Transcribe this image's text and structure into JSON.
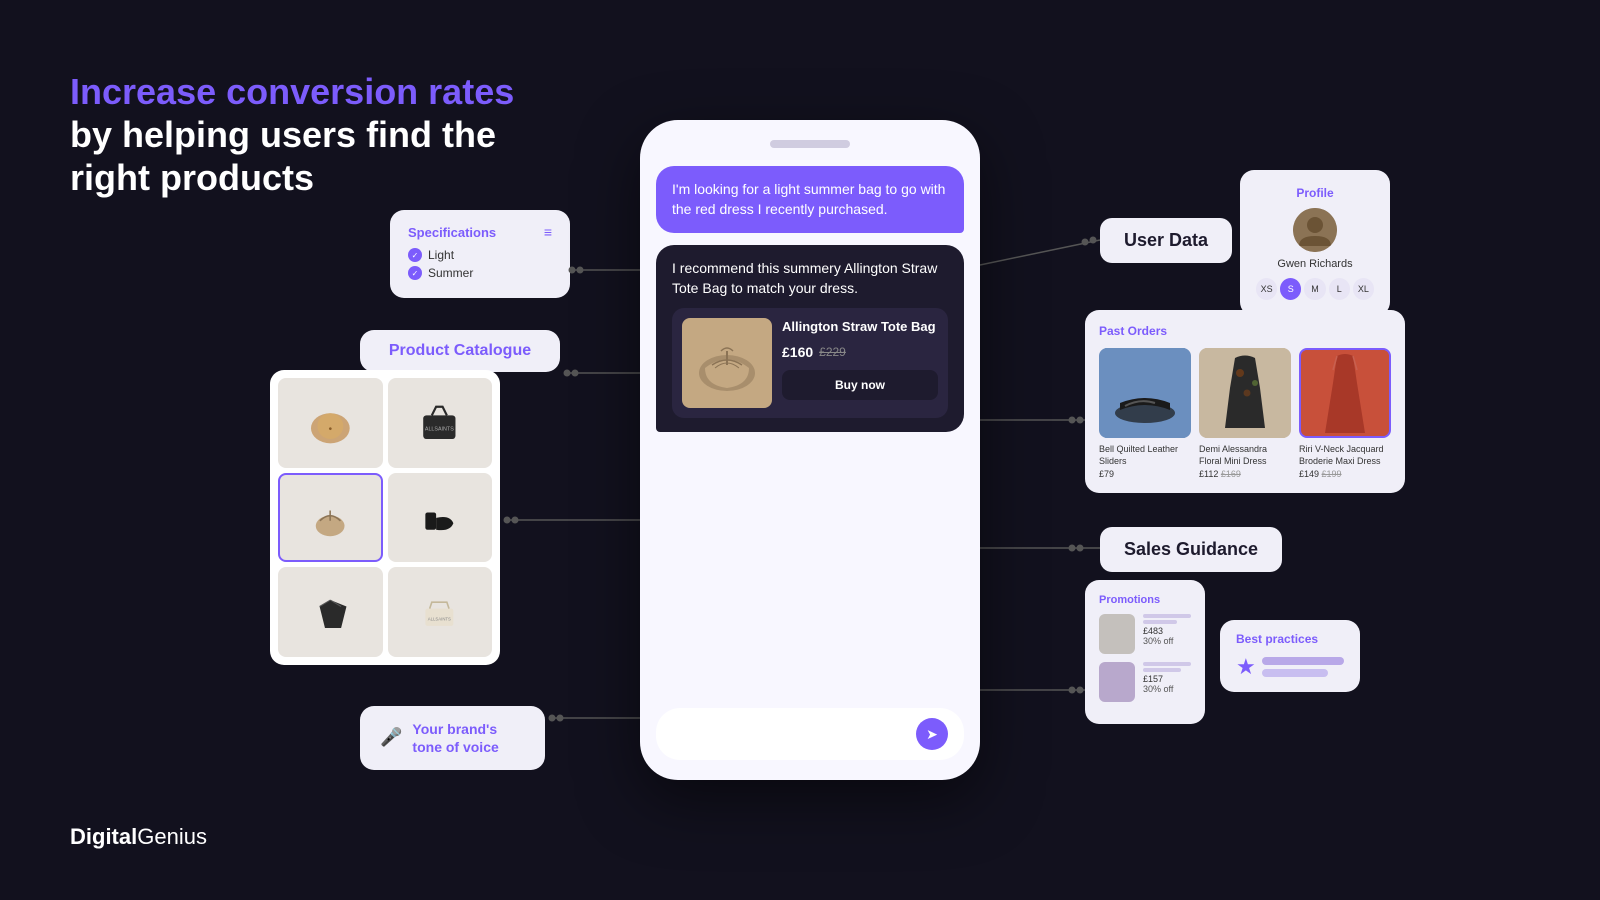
{
  "headline": {
    "accent": "Increase conversion rates",
    "main": "by helping users find the\nright products"
  },
  "logo": {
    "text_bold": "Digital",
    "text_regular": "Genius"
  },
  "spec_card": {
    "title": "Specifications",
    "items": [
      "Light",
      "Summer"
    ]
  },
  "catalogue_card": {
    "label": "Product Catalogue"
  },
  "voice_card": {
    "label": "Your brand's\ntone of voice"
  },
  "chat": {
    "user_message": "I'm looking for a light summer bag to go with the red dress I recently purchased.",
    "ai_intro": "I recommend this summery Allington Straw Tote Bag to match your dress.",
    "product": {
      "name": "Allington Straw Tote Bag",
      "price": "£160",
      "price_old": "£229",
      "buy_label": "Buy now"
    },
    "input_placeholder": ""
  },
  "right_panel": {
    "user_data_label": "User Data",
    "profile": {
      "title": "Profile",
      "name": "Gwen Richards",
      "sizes": [
        "XS",
        "S",
        "M",
        "L",
        "XL"
      ],
      "active_size": "S"
    },
    "past_orders": {
      "title": "Past Orders",
      "items": [
        {
          "name": "Bell Quilted Leather Sliders",
          "price": "£79"
        },
        {
          "name": "Demi Alessandra Floral Mini Dress",
          "price": "£112",
          "price_old": "£169"
        },
        {
          "name": "Riri V-Neck Jacquard Broderie Maxi Dress",
          "price": "£149",
          "price_old": "£199",
          "highlighted": true
        }
      ]
    },
    "sales_guidance_label": "Sales Guidance",
    "promotions": {
      "title": "Promotions",
      "items": [
        {
          "price": "£483",
          "off": "30% off"
        },
        {
          "price": "£157",
          "off": "30% off"
        }
      ]
    },
    "best_practices": {
      "title": "Best practices"
    }
  }
}
